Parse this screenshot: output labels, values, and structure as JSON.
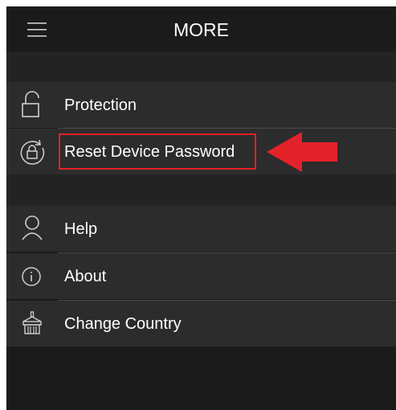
{
  "header": {
    "title": "MORE",
    "menu_icon": "hamburger-menu-icon"
  },
  "menu": {
    "protection": {
      "label": "Protection",
      "icon": "lock-icon"
    },
    "reset_password": {
      "label": "Reset Device Password",
      "icon": "reset-lock-icon"
    },
    "help": {
      "label": "Help",
      "icon": "user-icon"
    },
    "about": {
      "label": "About",
      "icon": "info-icon"
    },
    "change_country": {
      "label": "Change Country",
      "icon": "building-icon"
    }
  },
  "annotation": {
    "highlight_color": "#e3222a",
    "arrow_color": "#e3222a"
  },
  "colors": {
    "background": "#1b1b1b",
    "row_background": "#2c2c2c",
    "text": "#ffffff",
    "icon": "#cfcfcf"
  }
}
